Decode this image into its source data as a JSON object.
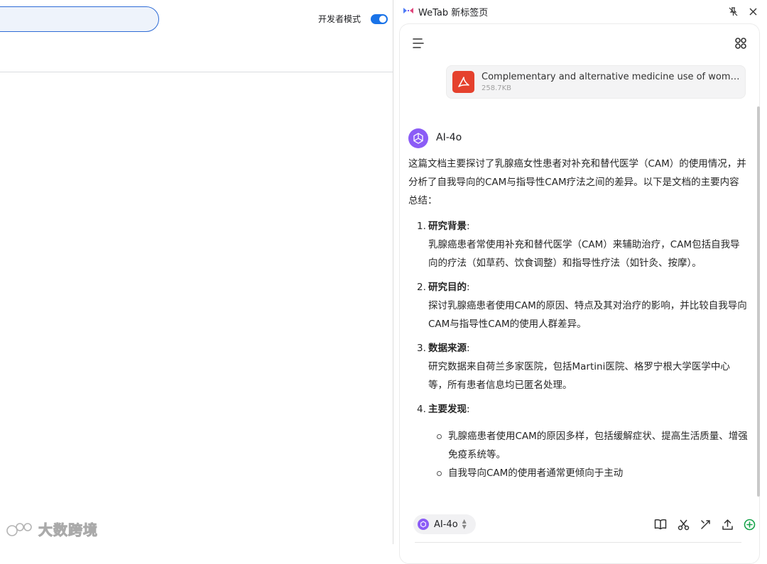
{
  "left": {
    "dev_mode_label": "开发者模式",
    "dev_mode_on": true,
    "watermark": "大数跨境"
  },
  "panel": {
    "title": "WeTab 新标签页",
    "accent": "#8b5cf6",
    "file": {
      "name": "Complementary and alternative medicine use of women with breast cancer",
      "size": "258.7KB"
    },
    "assistant_name": "AI-4o",
    "message": {
      "intro": "这篇文档主要探讨了乳腺癌女性患者对补充和替代医学（CAM）的使用情况，并分析了自我导向的CAM与指导性CAM疗法之间的差异。以下是文档的主要内容总结：",
      "points": [
        {
          "num": "1.",
          "title": "研究背景",
          "body": "乳腺癌患者常使用补充和替代医学（CAM）来辅助治疗，CAM包括自我导向的疗法（如草药、饮食调整）和指导性疗法（如针灸、按摩）。"
        },
        {
          "num": "2.",
          "title": "研究目的",
          "body": "探讨乳腺癌患者使用CAM的原因、特点及其对治疗的影响，并比较自我导向CAM与指导性CAM的使用人群差异。"
        },
        {
          "num": "3.",
          "title": "数据来源",
          "body": "研究数据来自荷兰多家医院，包括Martini医院、格罗宁根大学医学中心等，所有患者信息均已匿名处理。"
        },
        {
          "num": "4.",
          "title": "主要发现",
          "body": ""
        }
      ],
      "subpoints": [
        "乳腺癌患者使用CAM的原因多样，包括缓解症状、提高生活质量、增强免疫系统等。",
        "自我导向CAM的使用者通常更倾向于主动"
      ]
    },
    "composer": {
      "model": "AI-4o"
    }
  }
}
